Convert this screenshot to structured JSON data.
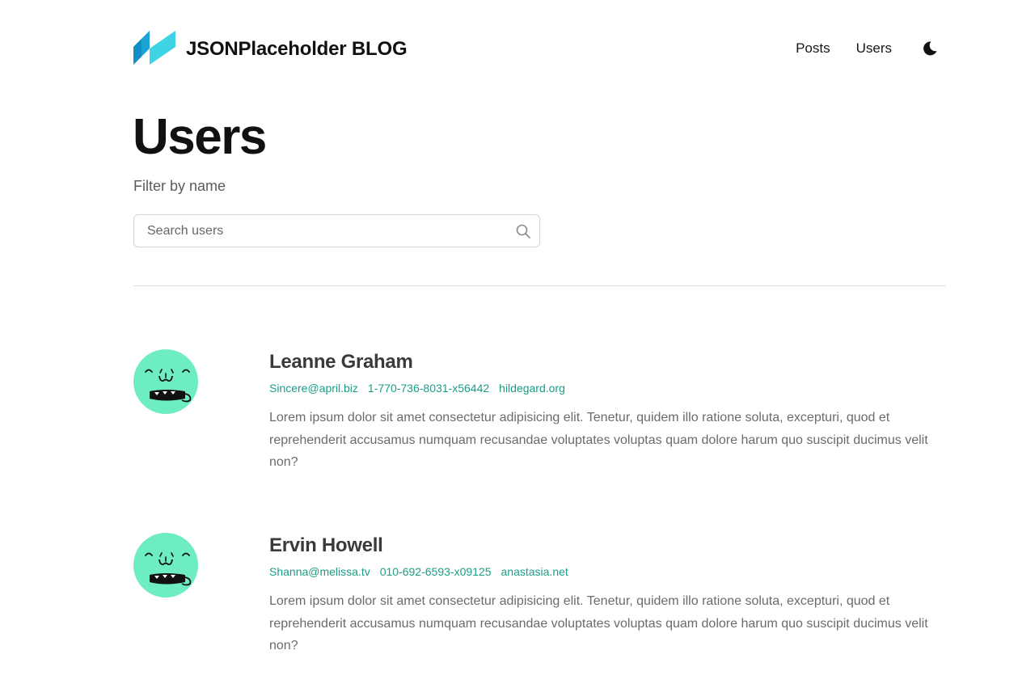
{
  "header": {
    "site_title": "JSONPlaceholder BLOG",
    "logo_icon": "logo-icon",
    "nav": [
      {
        "label": "Posts"
      },
      {
        "label": "Users"
      }
    ],
    "theme_toggle_icon": "moon-icon"
  },
  "page": {
    "title": "Users",
    "filter_label": "Filter by name"
  },
  "search": {
    "placeholder": "Search users",
    "value": "",
    "icon": "search-icon"
  },
  "users": [
    {
      "name": "Leanne Graham",
      "email": "Sincere@april.biz",
      "phone": "1-770-736-8031-x56442",
      "website": "hildegard.org",
      "bio": "Lorem ipsum dolor sit amet consectetur adipisicing elit. Tenetur, quidem illo ratione soluta, excepturi, quod et reprehenderit accusamus numquam recusandae voluptates voluptas quam dolore harum quo suscipit ducimus velit non?"
    },
    {
      "name": "Ervin Howell",
      "email": "Shanna@melissa.tv",
      "phone": "010-692-6593-x09125",
      "website": "anastasia.net",
      "bio": "Lorem ipsum dolor sit amet consectetur adipisicing elit. Tenetur, quidem illo ratione soluta, excepturi, quod et reprehenderit accusamus numquam recusandae voluptates voluptas quam dolore harum quo suscipit ducimus velit non?"
    }
  ],
  "colors": {
    "accent": "#1a9e86",
    "avatar_bg": "#6eedc5",
    "logo_dark": "#1ca3d6",
    "logo_light": "#3fd3e6"
  }
}
